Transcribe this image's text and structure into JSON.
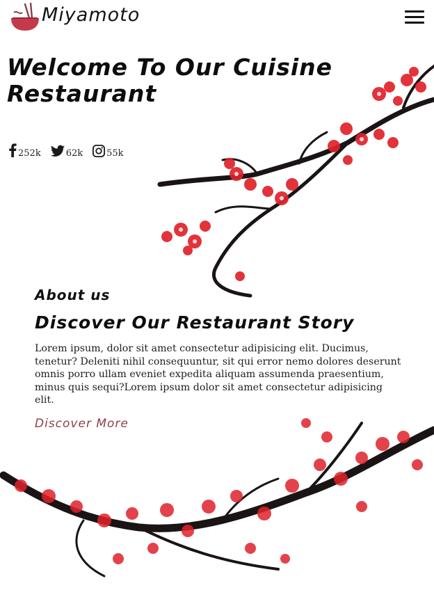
{
  "brand": {
    "name": "Miyamoto",
    "accent": "#c43a4a",
    "link_color": "#8e3f4a",
    "blossom_color": "#e0222b"
  },
  "header": {
    "logo_icon": "noodle-bowl-icon",
    "menu_icon": "hamburger-menu-icon"
  },
  "hero": {
    "title": "Welcome To Our Cuisine Restaurant"
  },
  "social": [
    {
      "icon": "facebook-icon",
      "count": "252k"
    },
    {
      "icon": "twitter-icon",
      "count": "62k"
    },
    {
      "icon": "instagram-icon",
      "count": "55k"
    }
  ],
  "about": {
    "label": "About us",
    "title": "Discover Our Restaurant Story",
    "text": "Lorem ipsum, dolor sit amet consectetur adipisicing elit. Ducimus, tenetur? Deleniti nihil consequuntur, sit qui error nemo dolores deserunt omnis porro ullam eveniet expedita aliquam assumenda praesentium, minus quis sequi?Lorem ipsum dolor sit amet consectetur adipisicing elit.",
    "link_label": "Discover More"
  }
}
